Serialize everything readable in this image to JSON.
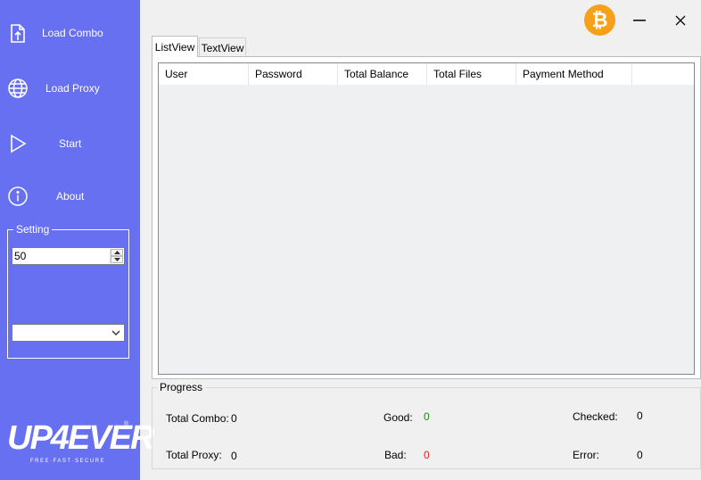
{
  "sidebar": {
    "items": [
      {
        "label": "Load Combo",
        "icon": "file-upload-icon"
      },
      {
        "label": "Load Proxy",
        "icon": "globe-icon"
      },
      {
        "label": "Start",
        "icon": "play-icon"
      },
      {
        "label": "About",
        "icon": "info-icon"
      }
    ],
    "setting": {
      "legend": "Setting",
      "threads_value": "50",
      "combo_selected": ""
    },
    "logo": {
      "text": "UP4EVER",
      "tagline": "FREE·FAST·SECURE",
      "registered": "®"
    },
    "colors": {
      "background": "#6670f0"
    }
  },
  "titlebar": {
    "bitcoin_icon": "bitcoin-icon",
    "bitcoin_symbol": "₿",
    "bitcoin_color": "#f7a11a",
    "minimize_icon": "minimize-icon",
    "close_icon": "close-icon"
  },
  "tabs": [
    {
      "label": "ListView",
      "active": true
    },
    {
      "label": "TextView",
      "active": false
    }
  ],
  "listview": {
    "columns": [
      "User",
      "Password",
      "Total Balance",
      "Total Files",
      "Payment Method"
    ],
    "rows": []
  },
  "progress": {
    "legend": "Progress",
    "total_combo_label": "Total Combo:",
    "total_combo_value": "0",
    "total_proxy_label": "Total Proxy:",
    "total_proxy_value": "0",
    "good_label": "Good:",
    "good_value": "0",
    "good_color": "#1a8a1a",
    "bad_label": "Bad:",
    "bad_value": "0",
    "bad_color": "#e02020",
    "checked_label": "Checked:",
    "checked_value": "0",
    "error_label": "Error:",
    "error_value": "0"
  }
}
